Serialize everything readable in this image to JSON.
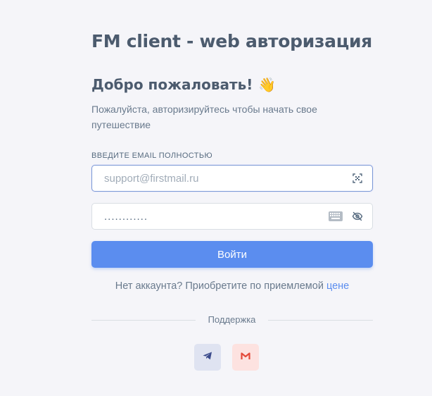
{
  "header": {
    "app_title": "FM client - web авторизация",
    "welcome": "Добро пожаловать!",
    "wave_emoji": "👋",
    "subtitle": "Пожалуйста, авторизируйтесь чтобы начать свое путешествие"
  },
  "form": {
    "email_label": "ВВЕДИТЕ EMAIL ПОЛНОСТЬЮ",
    "email_placeholder": "support@firstmail.ru",
    "email_value": "",
    "password_value": "............",
    "login_button": "Войти"
  },
  "signup": {
    "text": "Нет аккаунта? Приобретите по приемлемой",
    "link": "цене"
  },
  "support": {
    "label": "Поддержка",
    "buttons": [
      {
        "name": "telegram",
        "icon": "telegram-icon",
        "color": "#3b4b8c"
      },
      {
        "name": "gmail",
        "icon": "gmail-icon",
        "color": "#e44a3a"
      }
    ]
  },
  "colors": {
    "primary": "#5b8def",
    "background": "#f5f5f9",
    "heading": "#4c5b6e"
  }
}
